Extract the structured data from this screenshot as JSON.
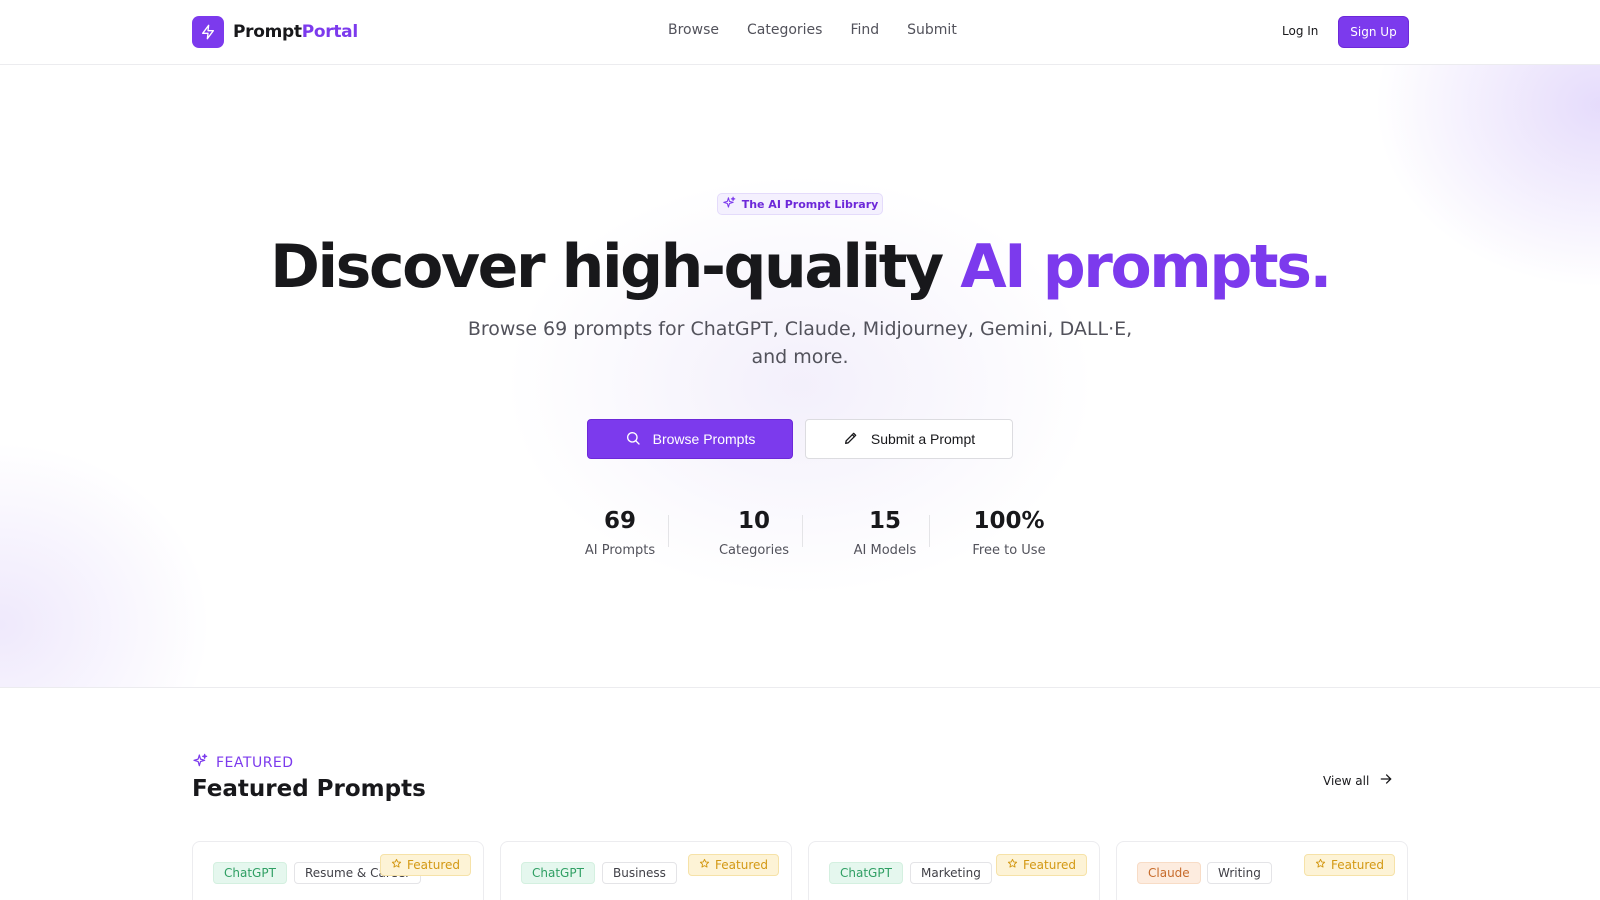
{
  "header": {
    "logo_main": "Prompt",
    "logo_accent": "Portal",
    "nav": [
      "Browse",
      "Categories",
      "Find",
      "Submit"
    ],
    "login_label": "Log In",
    "signup_label": "Sign Up"
  },
  "hero": {
    "pill_label": "The AI Prompt Library",
    "headline_main": "Discover high-quality ",
    "headline_accent": "AI prompts.",
    "subtitle": "Browse 69 prompts for ChatGPT, Claude, Midjourney, Gemini, DALL·E, and more.",
    "primary_button": "Browse Prompts",
    "secondary_button": "Submit a Prompt",
    "stats": [
      {
        "value": "69",
        "label": "AI Prompts"
      },
      {
        "value": "10",
        "label": "Categories"
      },
      {
        "value": "15",
        "label": "AI Models"
      },
      {
        "value": "100%",
        "label": "Free to Use"
      }
    ]
  },
  "featured": {
    "kicker": "FEATURED",
    "title": "Featured Prompts",
    "view_all": "View all",
    "cards": [
      {
        "model": "ChatGPT",
        "category": "Resume & Career",
        "badge": "Featured"
      },
      {
        "model": "ChatGPT",
        "category": "Business",
        "badge": "Featured"
      },
      {
        "model": "ChatGPT",
        "category": "Marketing",
        "badge": "Featured"
      },
      {
        "model": "Claude",
        "category": "Writing",
        "badge": "Featured"
      }
    ]
  },
  "colors": {
    "accent": "#7c3aed",
    "chatgpt_tag": "#2f9f63",
    "claude_tag": "#c76b2b",
    "featured_badge": "#d39813"
  },
  "icons": {
    "logo": "lightning-bolt-icon",
    "pill": "sparkles-icon",
    "primary_button": "search-icon",
    "secondary_button": "pencil-icon",
    "view_all": "arrow-right-icon",
    "featured_badge": "star-icon"
  }
}
